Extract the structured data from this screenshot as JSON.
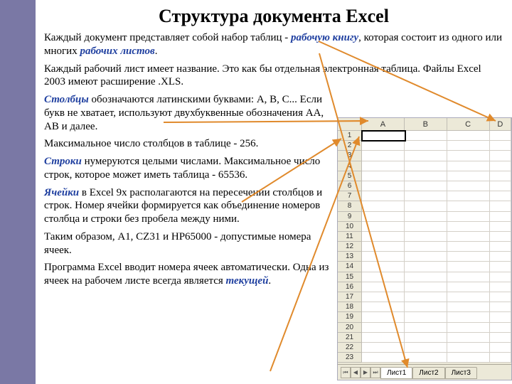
{
  "title": "Структура документа Excel",
  "p1a": "Каждый документ представляет собой набор таблиц - ",
  "p1b": "рабочую книгу",
  "p1c": ", которая состоит из одного или многих ",
  "p1d": "рабочих листов",
  "p1e": ".",
  "p2": "Каждый рабочий лист имеет название. Это как бы отдельная электронная таблица. Файлы Excel 2003 имеют расширение .XLS.",
  "p3a": "Столбцы",
  "p3b": " обозначаются латинскими буквами: A, B, C... Если букв не хватает, используют двухбуквенные обозначения AA, AB и далее.",
  "p4": "Максимальное число столбцов в таблице - 256.",
  "p5a": "Строки",
  "p5b": " нумеруются целыми числами. Максимальное число строк, которое может иметь таблица - 65536.",
  "p6a": "Ячейки",
  "p6b": " в Excel 9x располагаются на пересечении столбцов и строк.   Номер ячейки формируется как объединение номеров столбца и строки без пробела между ними.",
  "p7": "Таким образом, A1, CZ31 и HP65000 - допустимые номера ячеек.",
  "p8a": "Программа Excel вводит номера ячеек автоматически.   Одна из ячеек на рабочем листе всегда является ",
  "p8b": "текущей",
  "p8c": ".",
  "excel": {
    "cols": [
      "A",
      "B",
      "C",
      "D"
    ],
    "rows": [
      "1",
      "2",
      "3",
      "4",
      "5",
      "6",
      "7",
      "8",
      "9",
      "10",
      "11",
      "12",
      "13",
      "14",
      "15",
      "16",
      "17",
      "18",
      "19",
      "20",
      "21",
      "22",
      "23"
    ],
    "tabs": [
      "Лист1",
      "Лист2",
      "Лист3"
    ]
  }
}
